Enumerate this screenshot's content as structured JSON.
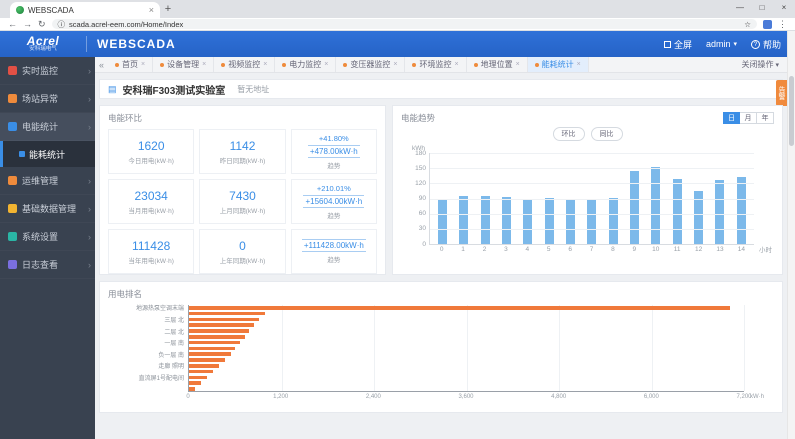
{
  "browser": {
    "tab_title": "WEBSCADA",
    "url": "scada.acrel-eem.com/Home/Index",
    "close_icon": "×",
    "new_tab_icon": "+",
    "win_min": "—",
    "win_max": "□",
    "win_close": "×",
    "back_icon": "←",
    "forward_icon": "→",
    "reload_icon": "↻",
    "info_icon": "ⓘ",
    "bookmark_icon": "☆",
    "menu_icon": "⋮"
  },
  "header": {
    "logo_line1": "Acrel",
    "logo_line2": "安科瑞电气",
    "app_title": "WEBSCADA",
    "fullscreen_label": "全屏",
    "user_label": "admin",
    "caret_icon": "▾",
    "help_icon": "?",
    "help_label": "帮助",
    "accent_color": "#2a6bd4"
  },
  "sidebar": {
    "items": [
      {
        "label": "实时监控",
        "icon": "monitor-icon",
        "color": "#e25045"
      },
      {
        "label": "场站异常",
        "icon": "alert-icon",
        "color": "#ef8b3c"
      },
      {
        "label": "电能统计",
        "icon": "energy-chart-icon",
        "color": "#3a8ee6",
        "expanded": true
      },
      {
        "label": "能耗统计",
        "sub": true,
        "selected": true
      },
      {
        "label": "运维管理",
        "icon": "wrench-icon",
        "color": "#ef8b3c"
      },
      {
        "label": "基础数据管理",
        "icon": "database-icon",
        "color": "#f2b431"
      },
      {
        "label": "系统设置",
        "icon": "gear-icon",
        "color": "#2ab5a5"
      },
      {
        "label": "日志查看",
        "icon": "log-icon",
        "color": "#7a6fe0"
      }
    ]
  },
  "tabs": {
    "collapse_icon": "«",
    "items": [
      "首页",
      "设备管理",
      "视频监控",
      "电力监控",
      "变压器监控",
      "环境监控",
      "地理位置",
      "能耗统计"
    ],
    "active_index": 7,
    "close_icon": "×",
    "close_menu_label": "关闭操作",
    "caret_icon": "▾"
  },
  "station": {
    "name": "安科瑞F303测试实验室",
    "address": "暂无地址",
    "alarm_tag": "告警"
  },
  "energy_compare": {
    "title": "电能环比",
    "trend_label": "趋势",
    "rows": [
      {
        "value": "1620",
        "label": "今日用电(kW·h)",
        "prev": "1142",
        "prev_label": "昨日同期(kW·h)",
        "pct": "+41.80%",
        "delta": "+478.00kW·h"
      },
      {
        "value": "23034",
        "label": "当月用电(kW·h)",
        "prev": "7430",
        "prev_label": "上月同期(kW·h)",
        "pct": "+210.01%",
        "delta": "+15604.00kW·h"
      },
      {
        "value": "111428",
        "label": "当年用电(kW·h)",
        "prev": "0",
        "prev_label": "上年同期(kW·h)",
        "pct": "",
        "delta": "+111428.00kW·h"
      }
    ]
  },
  "chart_data": [
    {
      "type": "bar",
      "title": "电能趋势",
      "unit": "kWh",
      "xlabel": "小时",
      "x": [
        "0",
        "1",
        "2",
        "3",
        "4",
        "5",
        "6",
        "7",
        "8",
        "9",
        "10",
        "11",
        "12",
        "13",
        "14"
      ],
      "values": [
        90,
        95,
        95,
        93,
        90,
        92,
        89,
        88,
        91,
        145,
        152,
        128,
        105,
        127,
        132
      ],
      "ylim": [
        0,
        180
      ],
      "yticks": [
        180,
        150,
        120,
        90,
        60,
        30,
        0
      ],
      "bar_color": "#7cb9ea",
      "period_buttons": [
        "日",
        "月",
        "年"
      ],
      "active_period": "日",
      "compare_buttons": [
        "环比",
        "同比"
      ],
      "legend_position": "top-right",
      "grid": true
    },
    {
      "type": "bar",
      "orientation": "horizontal",
      "title": "用电排名",
      "unit": "kW·h",
      "categories": [
        "地源热泵空调末端",
        "",
        "三层 北",
        "",
        "二层 北",
        "",
        "一层 南",
        "",
        "负一层 南",
        "",
        "走廊 照明",
        "",
        "直流屏1号配电间",
        "",
        ""
      ],
      "values": [
        7000,
        980,
        900,
        840,
        780,
        720,
        660,
        600,
        540,
        470,
        390,
        310,
        230,
        150,
        80
      ],
      "xlim": [
        0,
        7200
      ],
      "xticks": [
        "0",
        "1,200",
        "2,400",
        "3,600",
        "4,800",
        "6,000",
        "7,200"
      ],
      "bar_color": "#f0793a",
      "grid": true
    }
  ]
}
